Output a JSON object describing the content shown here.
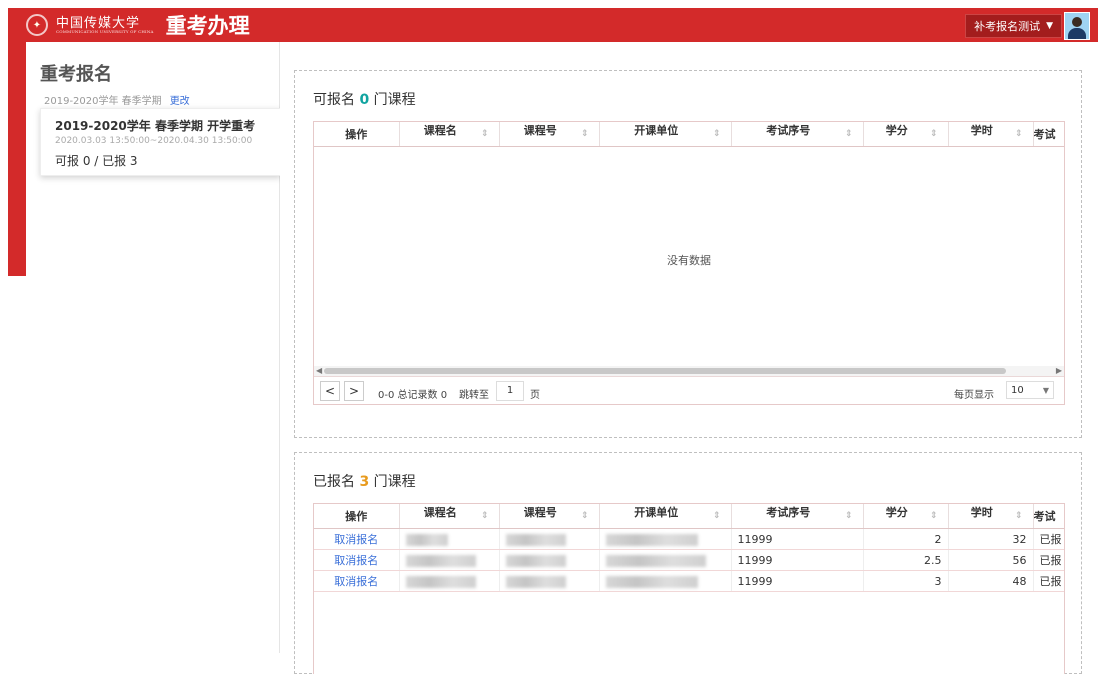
{
  "header": {
    "logo_cn": "中国传媒大学",
    "logo_en": "COMMUNICATION UNIVERSITY OF CHINA",
    "app_title": "重考办理",
    "user_label": "补考报名测试"
  },
  "sidebar": {
    "title": "重考报名",
    "term": "2019-2020学年 春季学期",
    "change_link": "更改",
    "card": {
      "name": "2019-2020学年 春季学期 开学重考",
      "range": "2020.03.03 13:50:00~2020.04.30 13:50:00",
      "counts": "可报 0 / 已报 3"
    }
  },
  "available": {
    "title_prefix": "可报名",
    "count": "0",
    "title_suffix": "门课程",
    "columns": [
      "操作",
      "课程名",
      "课程号",
      "开课单位",
      "考试序号",
      "学分",
      "学时",
      "考试"
    ],
    "empty_text": "没有数据",
    "pager": {
      "prev": "<",
      "next": ">",
      "summary": "0-0 总记录数 0",
      "jump_label": "跳转至",
      "page": "1",
      "page_suffix": "页",
      "per_page_label": "每页显示",
      "per_page_value": "10"
    }
  },
  "registered": {
    "title_prefix": "已报名",
    "count": "3",
    "title_suffix": "门课程",
    "columns": [
      "操作",
      "课程名",
      "课程号",
      "开课单位",
      "考试序号",
      "学分",
      "学时",
      "考试"
    ],
    "rows": [
      {
        "action": "取消报名",
        "exam_no": "11999",
        "credit": "2",
        "hours": "32",
        "status": "已报"
      },
      {
        "action": "取消报名",
        "exam_no": "11999",
        "credit": "2.5",
        "hours": "56",
        "status": "已报"
      },
      {
        "action": "取消报名",
        "exam_no": "11999",
        "credit": "3",
        "hours": "48",
        "status": "已报"
      }
    ]
  },
  "colors": {
    "brand_red": "#d32a2a",
    "link_blue": "#3a6fd8",
    "teal": "#11a4a0",
    "orange": "#e89b1f"
  }
}
